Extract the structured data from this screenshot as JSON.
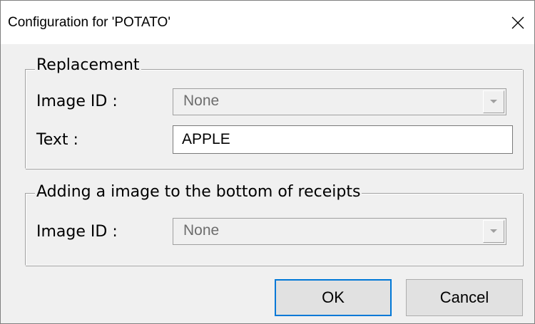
{
  "window": {
    "title": "Configuration for 'POTATO'",
    "close_icon": "close-icon"
  },
  "replacement_group": {
    "legend": "Replacement",
    "image_id_label": "Image  ID :",
    "image_id_value": "None",
    "text_label": "Text :",
    "text_value": "APPLE"
  },
  "receipt_group": {
    "legend": "Adding a image to the bottom of receipts",
    "image_id_label": "Image  ID :",
    "image_id_value": "None"
  },
  "buttons": {
    "ok_label": "OK",
    "cancel_label": "Cancel"
  },
  "colors": {
    "dialog_background": "#f0f0f0",
    "titlebar_background": "#ffffff",
    "disabled_text": "#6d6d6d",
    "default_button_border": "#0078d7"
  }
}
